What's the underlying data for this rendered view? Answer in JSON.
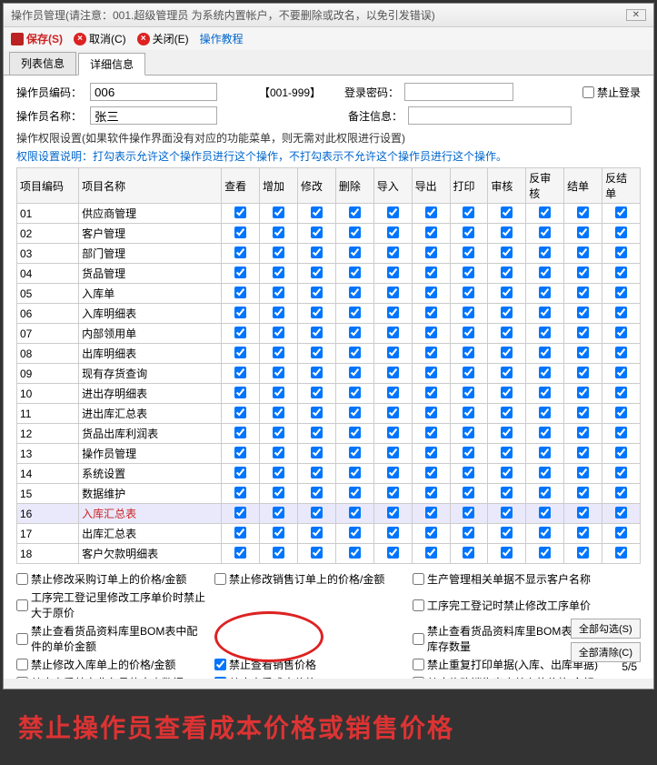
{
  "title": "操作员管理(请注意：001.超级管理员 为系统内置帐户，不要删除或改名，以免引发错误)",
  "toolbar": {
    "save": "保存(S)",
    "cancel": "取消(C)",
    "close": "关闭(E)",
    "help": "操作教程"
  },
  "tabs": [
    "列表信息",
    "详细信息"
  ],
  "form": {
    "code_label": "操作员编码：",
    "code_value": "006",
    "code_range": "【001-999】",
    "pwd_label": "登录密码：",
    "deny_login": "禁止登录",
    "name_label": "操作员名称：",
    "name_value": "张三",
    "note_label": "备注信息："
  },
  "perm_hint": "操作权限设置(如果软件操作界面没有对应的功能菜单，则无需对此权限进行设置)",
  "perm_blue": "权限设置说明：打勾表示允许这个操作员进行这个操作，不打勾表示不允许这个操作员进行这个操作。",
  "perm_cols": [
    "项目编码",
    "项目名称",
    "查看",
    "增加",
    "修改",
    "删除",
    "导入",
    "导出",
    "打印",
    "审核",
    "反审核",
    "结单",
    "反结单"
  ],
  "perm_rows": [
    {
      "id": "01",
      "name": "供应商管理"
    },
    {
      "id": "02",
      "name": "客户管理"
    },
    {
      "id": "03",
      "name": "部门管理"
    },
    {
      "id": "04",
      "name": "货品管理"
    },
    {
      "id": "05",
      "name": "入库单"
    },
    {
      "id": "06",
      "name": "入库明细表"
    },
    {
      "id": "07",
      "name": "内部领用单"
    },
    {
      "id": "08",
      "name": "出库明细表"
    },
    {
      "id": "09",
      "name": "现有存货查询"
    },
    {
      "id": "10",
      "name": "进出存明细表"
    },
    {
      "id": "11",
      "name": "进出库汇总表"
    },
    {
      "id": "12",
      "name": "货品出库利润表"
    },
    {
      "id": "13",
      "name": "操作员管理"
    },
    {
      "id": "14",
      "name": "系统设置"
    },
    {
      "id": "15",
      "name": "数据维护"
    },
    {
      "id": "16",
      "name": "入库汇总表",
      "hl": true
    },
    {
      "id": "17",
      "name": "出库汇总表"
    },
    {
      "id": "18",
      "name": "客户欠款明细表"
    }
  ],
  "bottom_checks": [
    "禁止修改采购订单上的价格/金额",
    "禁止修改销售订单上的价格/金额",
    "生产管理相关单据不显示客户名称",
    "工序完工登记里修改工序单价时禁止大于原价",
    "",
    "工序完工登记时禁止修改工序单价",
    "禁止查看货品资料库里BOM表中配件的单价金额",
    "",
    "禁止查看货品资料库里BOM表中配件的库存数量",
    "禁止修改入库单上的价格/金额",
    "禁止查看销售价格",
    "禁止重复打印单据(入库、出库单据)",
    "禁止查看其它业务员的客户数据",
    "禁止查看成本价格",
    "禁止修改销售出库单上的价格/金额"
  ],
  "circled_checked": [
    10,
    13
  ],
  "side_btns": {
    "all": "全部勾选(S)",
    "clear": "全部清除(C)"
  },
  "page": "5/5",
  "caption": "禁止操作员查看成本价格或销售价格"
}
